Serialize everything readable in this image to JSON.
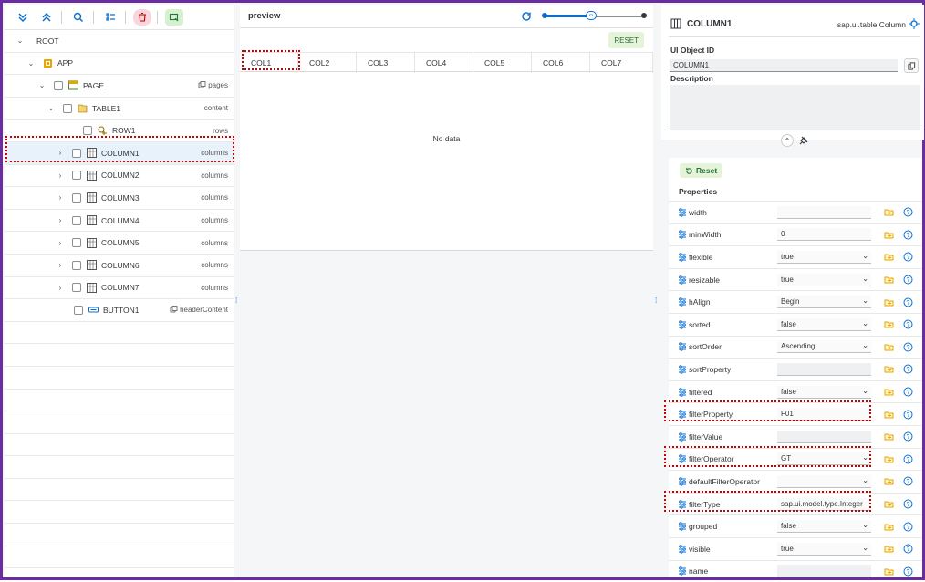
{
  "toolbar": {
    "icons": [
      "expand-all-icon",
      "collapse-all-icon",
      "search-icon",
      "tree-view-icon",
      "delete-icon",
      "visibility-icon"
    ]
  },
  "tree": [
    {
      "name": "ROOT",
      "agg": ""
    },
    {
      "name": "APP",
      "agg": ""
    },
    {
      "name": "PAGE",
      "agg": "pages"
    },
    {
      "name": "TABLE1",
      "agg": "content"
    },
    {
      "name": "ROW1",
      "agg": "rows"
    },
    {
      "name": "COLUMN1",
      "agg": "columns"
    },
    {
      "name": "COLUMN2",
      "agg": "columns"
    },
    {
      "name": "COLUMN3",
      "agg": "columns"
    },
    {
      "name": "COLUMN4",
      "agg": "columns"
    },
    {
      "name": "COLUMN5",
      "agg": "columns"
    },
    {
      "name": "COLUMN6",
      "agg": "columns"
    },
    {
      "name": "COLUMN7",
      "agg": "columns"
    },
    {
      "name": "BUTTON1",
      "agg": "headerContent"
    }
  ],
  "preview": {
    "title": "preview",
    "reset": "RESET",
    "columns": [
      "COL1",
      "COL2",
      "COL3",
      "COL4",
      "COL5",
      "COL6",
      "COL7"
    ],
    "nodata": "No data"
  },
  "details": {
    "title": "COLUMN1",
    "type": "sap.ui.table.Column",
    "id_label": "UI Object ID",
    "id_value": "COLUMN1",
    "desc_label": "Description",
    "reset": "Reset",
    "props_title": "Properties",
    "properties": [
      {
        "name": "width",
        "value": "",
        "kind": "input"
      },
      {
        "name": "minWidth",
        "value": "0",
        "kind": "input"
      },
      {
        "name": "flexible",
        "value": "true",
        "kind": "select"
      },
      {
        "name": "resizable",
        "value": "true",
        "kind": "select"
      },
      {
        "name": "hAlign",
        "value": "Begin",
        "kind": "select"
      },
      {
        "name": "sorted",
        "value": "false",
        "kind": "select"
      },
      {
        "name": "sortOrder",
        "value": "Ascending",
        "kind": "select"
      },
      {
        "name": "sortProperty",
        "value": "",
        "kind": "ro"
      },
      {
        "name": "filtered",
        "value": "false",
        "kind": "select"
      },
      {
        "name": "filterProperty",
        "value": "F01",
        "kind": "input"
      },
      {
        "name": "filterValue",
        "value": "",
        "kind": "ro"
      },
      {
        "name": "filterOperator",
        "value": "GT",
        "kind": "select"
      },
      {
        "name": "defaultFilterOperator",
        "value": "",
        "kind": "select"
      },
      {
        "name": "filterType",
        "value": "sap.ui.model.type.Integer",
        "kind": "input"
      },
      {
        "name": "grouped",
        "value": "false",
        "kind": "select"
      },
      {
        "name": "visible",
        "value": "true",
        "kind": "select"
      },
      {
        "name": "name",
        "value": "",
        "kind": "ro"
      }
    ]
  },
  "colors": {
    "accent": "#0a6ed1",
    "frame": "#6a2ca0",
    "highlight": "#cc0000"
  }
}
